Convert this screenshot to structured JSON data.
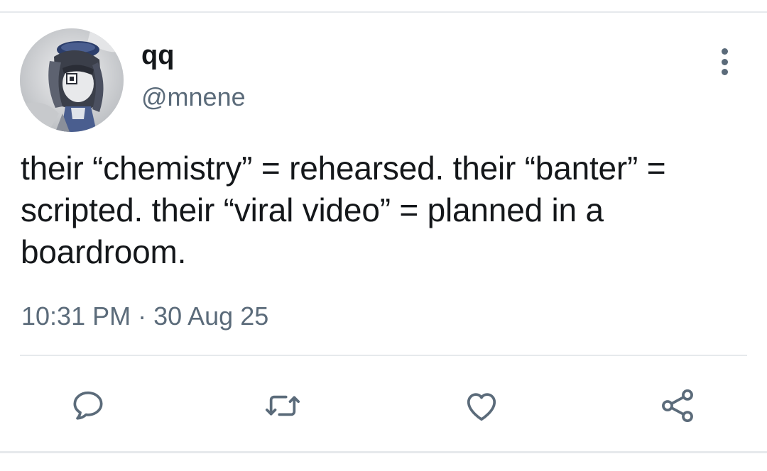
{
  "tweet": {
    "author": {
      "display_name": "qq",
      "handle": "@mnene"
    },
    "text": "their “chemistry” = rehearsed. their “banter” = scripted. their “viral video” = planned in a boardroom.",
    "timestamp": "10:31 PM · 30 Aug 25"
  },
  "icons": {
    "more": "more-vertical-icon",
    "reply": "reply-icon",
    "retweet": "retweet-icon",
    "like": "heart-icon",
    "share": "share-icon"
  },
  "colors": {
    "text": "#14171a",
    "secondary": "#5b6b7a",
    "divider": "#e6e9ec"
  }
}
